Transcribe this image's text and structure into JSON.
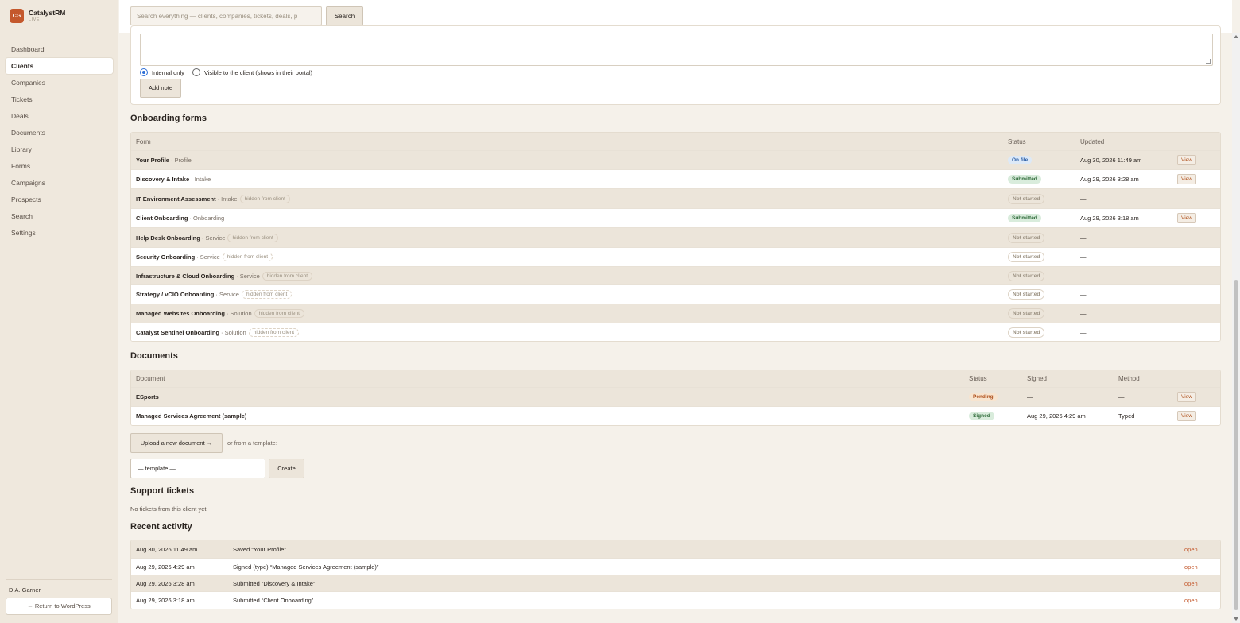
{
  "brand": {
    "logo": "CG",
    "name": "CatalystRM",
    "env": "LIVE"
  },
  "nav": [
    "Dashboard",
    "Clients",
    "Companies",
    "Tickets",
    "Deals",
    "Documents",
    "Library",
    "Forms",
    "Campaigns",
    "Prospects",
    "Search",
    "Settings"
  ],
  "nav_active": "Clients",
  "user": "D.A. Garner",
  "wp_button": "← Return to WordPress",
  "search": {
    "placeholder": "Search everything — clients, companies, tickets, deals, p",
    "button": "Search"
  },
  "note": {
    "radio_internal": "Internal only",
    "radio_visible": "Visible to the client (shows in their portal)",
    "add_button": "Add note"
  },
  "forms": {
    "title": "Onboarding forms",
    "columns": {
      "form": "Form",
      "status": "Status",
      "updated": "Updated"
    },
    "rows": [
      {
        "name": "Your Profile",
        "cat": "· Profile",
        "hidden": "",
        "status": "On file",
        "status_kind": "onfile",
        "updated": "Aug 30, 2026 11:49 am",
        "action": "View"
      },
      {
        "name": "Discovery & Intake",
        "cat": "· Intake",
        "hidden": "",
        "status": "Submitted",
        "status_kind": "submitted",
        "updated": "Aug 29, 2026 3:28 am",
        "action": "View"
      },
      {
        "name": "IT Environment Assessment",
        "cat": "· Intake",
        "hidden": "hidden from client",
        "status": "Not started",
        "status_kind": "notstarted",
        "updated": "—",
        "action": ""
      },
      {
        "name": "Client Onboarding",
        "cat": "· Onboarding",
        "hidden": "",
        "status": "Submitted",
        "status_kind": "submitted",
        "updated": "Aug 29, 2026 3:18 am",
        "action": "View"
      },
      {
        "name": "Help Desk Onboarding",
        "cat": "· Service",
        "hidden": "hidden from client",
        "status": "Not started",
        "status_kind": "notstarted",
        "updated": "—",
        "action": ""
      },
      {
        "name": "Security Onboarding",
        "cat": "· Service",
        "hidden": "hidden from client",
        "status": "Not started",
        "status_kind": "notstarted",
        "updated": "—",
        "action": ""
      },
      {
        "name": "Infrastructure & Cloud Onboarding",
        "cat": "· Service",
        "hidden": "hidden from client",
        "status": "Not started",
        "status_kind": "notstarted",
        "updated": "—",
        "action": ""
      },
      {
        "name": "Strategy / vCIO Onboarding",
        "cat": "· Service",
        "hidden": "hidden from client",
        "status": "Not started",
        "status_kind": "notstarted",
        "updated": "—",
        "action": ""
      },
      {
        "name": "Managed Websites Onboarding",
        "cat": "· Solution",
        "hidden": "hidden from client",
        "status": "Not started",
        "status_kind": "notstarted",
        "updated": "—",
        "action": ""
      },
      {
        "name": "Catalyst Sentinel Onboarding",
        "cat": "· Solution",
        "hidden": "hidden from client",
        "status": "Not started",
        "status_kind": "notstarted",
        "updated": "—",
        "action": ""
      }
    ]
  },
  "documents": {
    "title": "Documents",
    "columns": {
      "document": "Document",
      "status": "Status",
      "signed": "Signed",
      "method": "Method"
    },
    "rows": [
      {
        "name": "ESports",
        "status": "Pending",
        "status_kind": "pending",
        "signed": "—",
        "method": "—",
        "action": "View"
      },
      {
        "name": "Managed Services Agreement (sample)",
        "status": "Signed",
        "status_kind": "signed",
        "signed": "Aug 29, 2026 4:29 am",
        "method": "Typed",
        "action": "View"
      }
    ],
    "upload_button": "Upload a new document →",
    "or_text": "or from a template:",
    "template_select": "— template —",
    "create_button": "Create"
  },
  "tickets": {
    "title": "Support tickets",
    "empty": "No tickets from this client yet."
  },
  "activity": {
    "title": "Recent activity",
    "rows": [
      {
        "date": "Aug 30, 2026 11:49 am",
        "text": "Saved “Your Profile”",
        "link": "open"
      },
      {
        "date": "Aug 29, 2026 4:29 am",
        "text": "Signed (type) “Managed Services Agreement (sample)”",
        "link": "open"
      },
      {
        "date": "Aug 29, 2026 3:28 am",
        "text": "Submitted “Discovery & Intake”",
        "link": "open"
      },
      {
        "date": "Aug 29, 2026 3:18 am",
        "text": "Submitted “Client Onboarding”",
        "link": "open"
      }
    ]
  }
}
